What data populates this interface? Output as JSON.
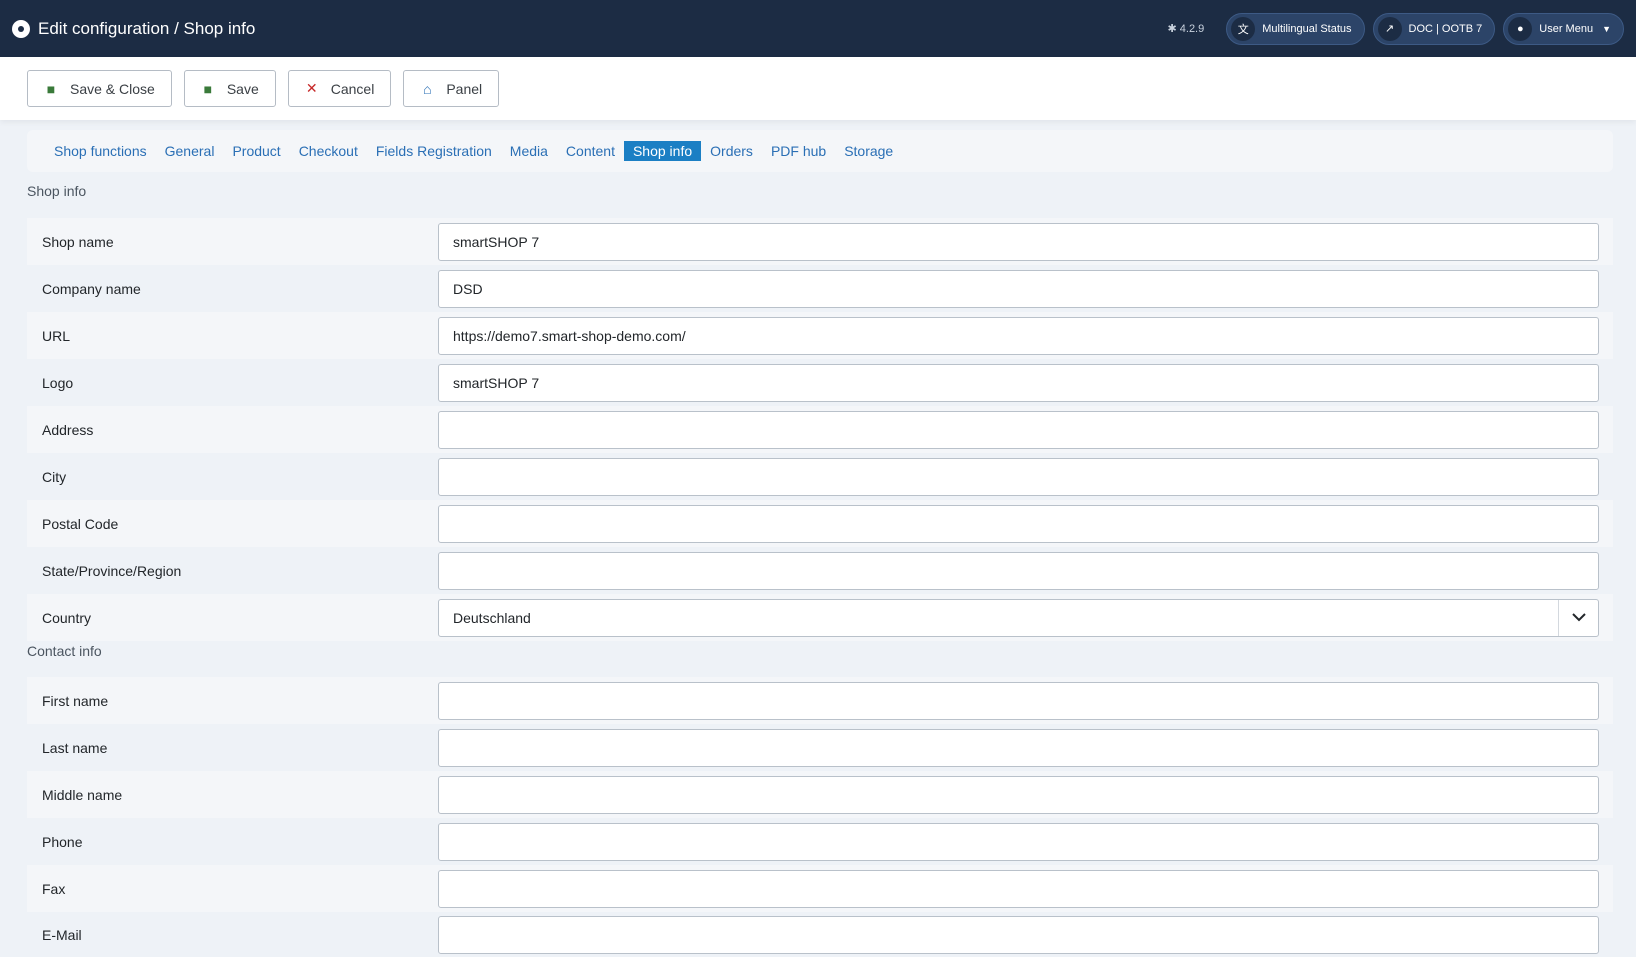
{
  "header": {
    "title": "Edit configuration / Shop info",
    "version": "4.2.9",
    "multilingual_label": "Multilingual Status",
    "doc_label": "DOC | OOTB 7",
    "user_menu_label": "User Menu"
  },
  "toolbar": {
    "save_close_label": "Save & Close",
    "save_label": "Save",
    "cancel_label": "Cancel",
    "panel_label": "Panel"
  },
  "tabs": [
    {
      "label": "Shop functions"
    },
    {
      "label": "General"
    },
    {
      "label": "Product"
    },
    {
      "label": "Checkout"
    },
    {
      "label": "Fields Registration"
    },
    {
      "label": "Media"
    },
    {
      "label": "Content"
    },
    {
      "label": "Shop info",
      "active": true
    },
    {
      "label": "Orders"
    },
    {
      "label": "PDF hub"
    },
    {
      "label": "Storage"
    }
  ],
  "shop_info": {
    "section_label": "Shop info",
    "shop_name": {
      "label": "Shop name",
      "value": "smartSHOP 7"
    },
    "company_name": {
      "label": "Company name",
      "value": "DSD"
    },
    "url": {
      "label": "URL",
      "value": "https://demo7.smart-shop-demo.com/"
    },
    "logo": {
      "label": "Logo",
      "value": "smartSHOP 7"
    },
    "address": {
      "label": "Address",
      "value": ""
    },
    "city": {
      "label": "City",
      "value": ""
    },
    "postal_code": {
      "label": "Postal Code",
      "value": ""
    },
    "state": {
      "label": "State/Province/Region",
      "value": ""
    },
    "country": {
      "label": "Country",
      "value": "Deutschland"
    }
  },
  "contact_info": {
    "section_label": "Contact info",
    "first_name": {
      "label": "First name",
      "value": ""
    },
    "last_name": {
      "label": "Last name",
      "value": ""
    },
    "middle_name": {
      "label": "Middle name",
      "value": ""
    },
    "phone": {
      "label": "Phone",
      "value": ""
    },
    "fax": {
      "label": "Fax",
      "value": ""
    },
    "email": {
      "label": "E-Mail",
      "value": ""
    }
  }
}
